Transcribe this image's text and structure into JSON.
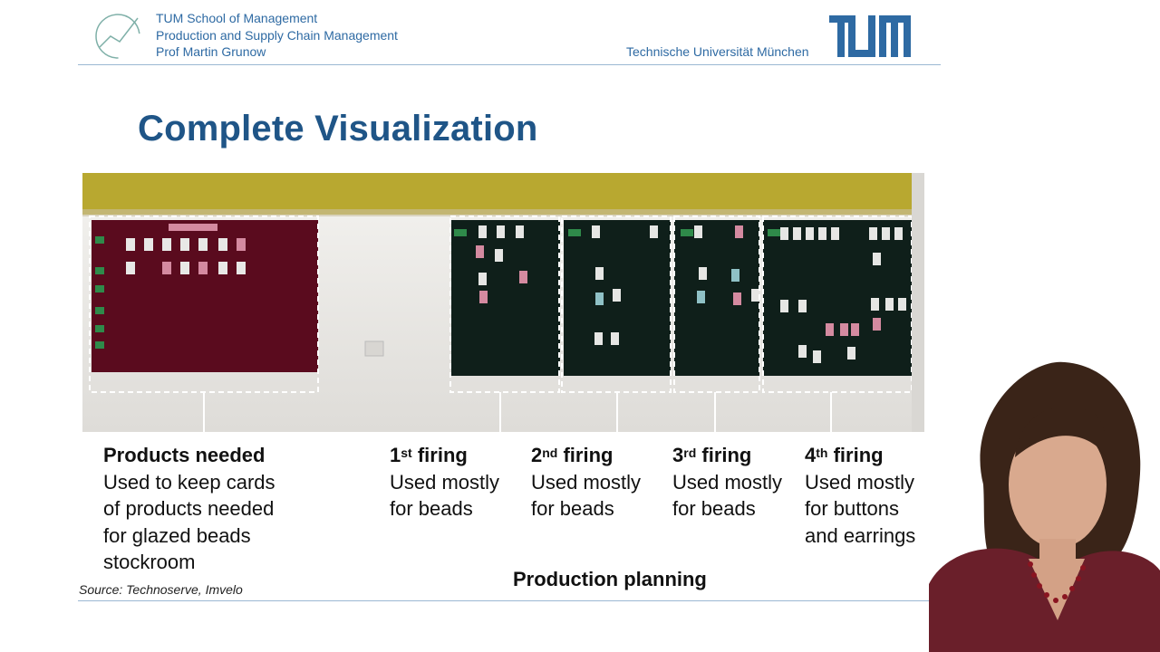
{
  "header": {
    "school": "TUM School of Management",
    "department": "Production and Supply Chain Management",
    "professor": "Prof Martin Grunow",
    "university": "Technische Universität München"
  },
  "slide": {
    "title": "Complete Visualization",
    "captions": [
      {
        "label": "Products needed",
        "lines": [
          "Used to keep cards",
          "of products needed",
          "for glazed beads",
          "stockroom"
        ]
      },
      {
        "num": "1",
        "sup": "st",
        "label": "firing",
        "lines": [
          "Used mostly",
          "for beads"
        ]
      },
      {
        "num": "2",
        "sup": "nd",
        "label": "firing",
        "lines": [
          "Used mostly",
          "for beads"
        ]
      },
      {
        "num": "3",
        "sup": "rd",
        "label": "firing",
        "lines": [
          "Used mostly",
          "for beads"
        ]
      },
      {
        "num": "4",
        "sup": "th",
        "label": "firing",
        "lines": [
          "Used mostly",
          "for buttons",
          "and earrings"
        ]
      }
    ],
    "group_label": "Production planning",
    "source": "Source: Technoserve, Imvelo"
  },
  "colors": {
    "accent_blue": "#1f5587",
    "header_blue": "#2e6aa3",
    "board_red": "#5a0b1e",
    "board_green": "#0f1f1a",
    "wall_yellow": "#b8a830"
  },
  "icons": {
    "logo_curve": "growth-curve-logo-icon",
    "tum_logo": "tum-logo-icon"
  }
}
